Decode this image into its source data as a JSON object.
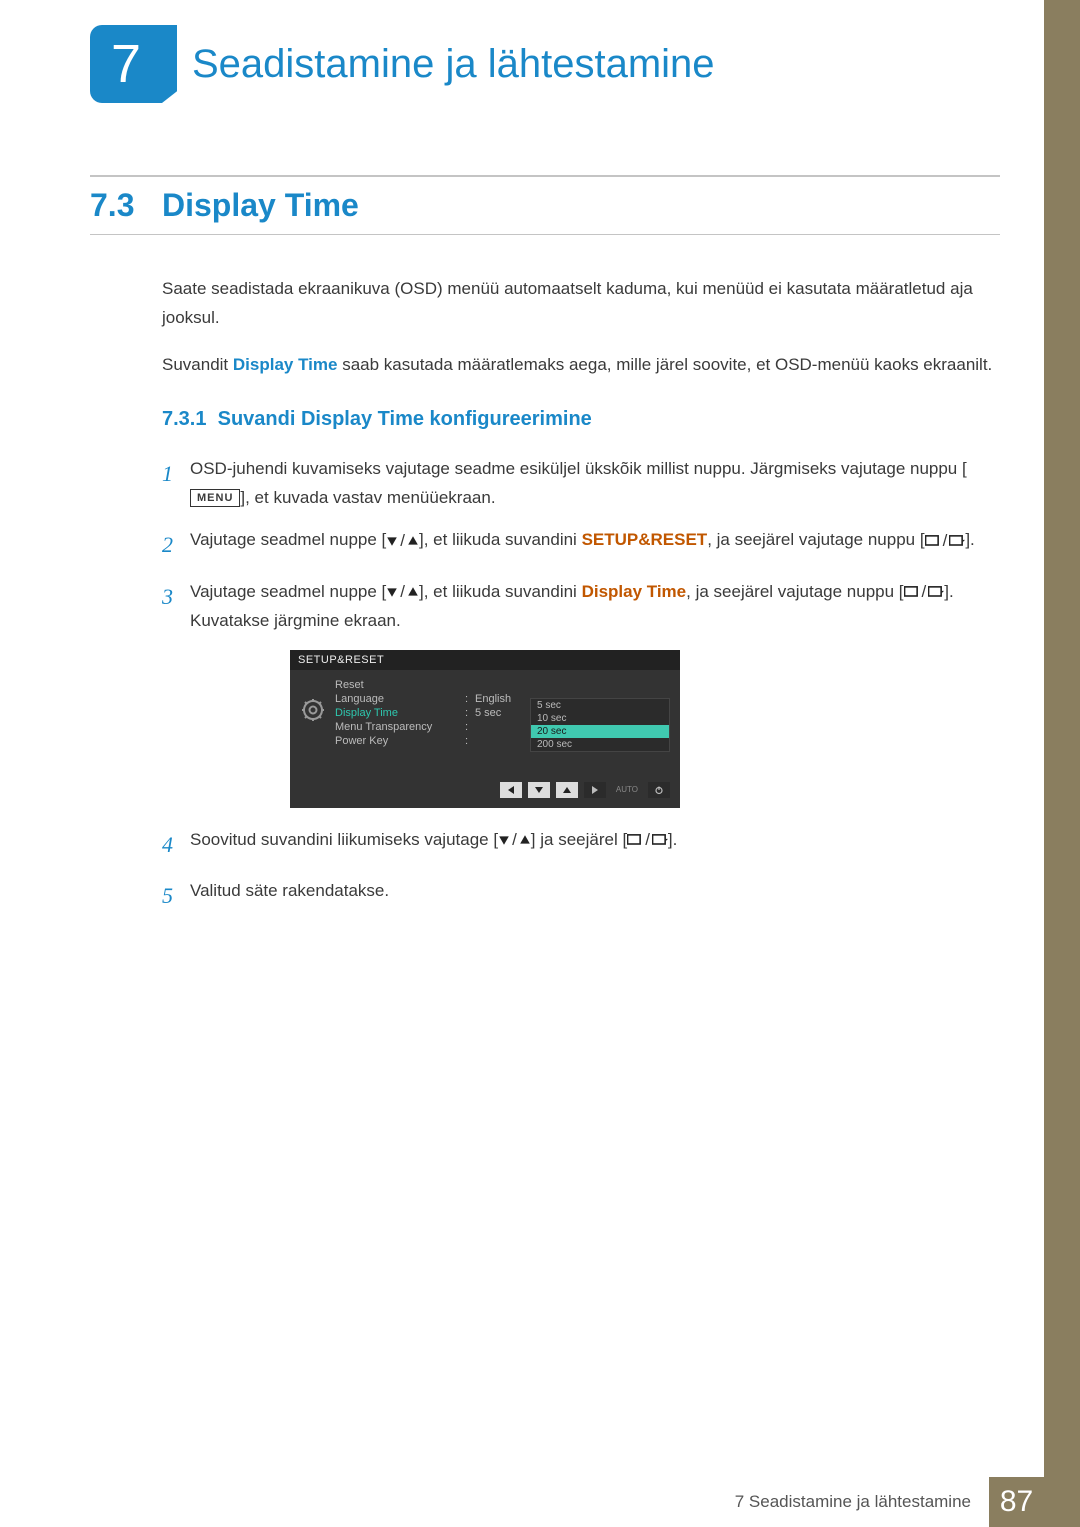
{
  "chapter": {
    "number": "7",
    "title": "Seadistamine ja lähtestamine"
  },
  "section": {
    "number": "7.3",
    "title": "Display Time",
    "intro1": "Saate seadistada ekraanikuva (OSD) menüü automaatselt kaduma, kui menüüd ei kasutata määratletud aja jooksul.",
    "intro2_pre": "Suvandit ",
    "intro2_strong": "Display Time",
    "intro2_post": " saab kasutada määratlemaks aega, mille järel soovite, et OSD-menüü kaoks ekraanilt."
  },
  "subsection": {
    "number": "7.3.1",
    "title": "Suvandi Display Time konfigureerimine"
  },
  "steps": {
    "s1": {
      "num": "1",
      "text_pre": "OSD-juhendi kuvamiseks vajutage seadme esiküljel ükskõik millist nuppu. Järgmiseks vajutage nuppu [",
      "menu": "MENU",
      "text_post": "], et kuvada vastav menüüekraan."
    },
    "s2": {
      "num": "2",
      "text_pre": "Vajutage seadmel nuppe [",
      "text_mid": "], et liikuda suvandini ",
      "strong": "SETUP&RESET",
      "text_post1": ", ja seejärel vajutage nuppu [",
      "text_post2": "]."
    },
    "s3": {
      "num": "3",
      "text_pre": "Vajutage seadmel nuppe [",
      "text_mid": "], et liikuda suvandini ",
      "strong": "Display Time",
      "text_post1": ", ja seejärel vajutage nuppu [",
      "text_post2": "]. Kuvatakse järgmine ekraan."
    },
    "s4": {
      "num": "4",
      "text_pre": "Soovitud suvandini liikumiseks vajutage [",
      "text_mid": "] ja seejärel [",
      "text_post": "]."
    },
    "s5": {
      "num": "5",
      "text": "Valitud säte rakendatakse."
    }
  },
  "osd": {
    "title": "SETUP&RESET",
    "rows": {
      "reset": "Reset",
      "language": "Language",
      "language_val": "English",
      "display_time": "Display Time",
      "display_time_val": "5 sec",
      "menu_transparency": "Menu Transparency",
      "power_key": "Power Key"
    },
    "options": {
      "o1": "5 sec",
      "o2": "10 sec",
      "o3": "20 sec",
      "o4": "200 sec"
    },
    "auto": "AUTO"
  },
  "footer": {
    "crumb_num": "7",
    "crumb_text": "Seadistamine ja lähtestamine",
    "page": "87"
  }
}
